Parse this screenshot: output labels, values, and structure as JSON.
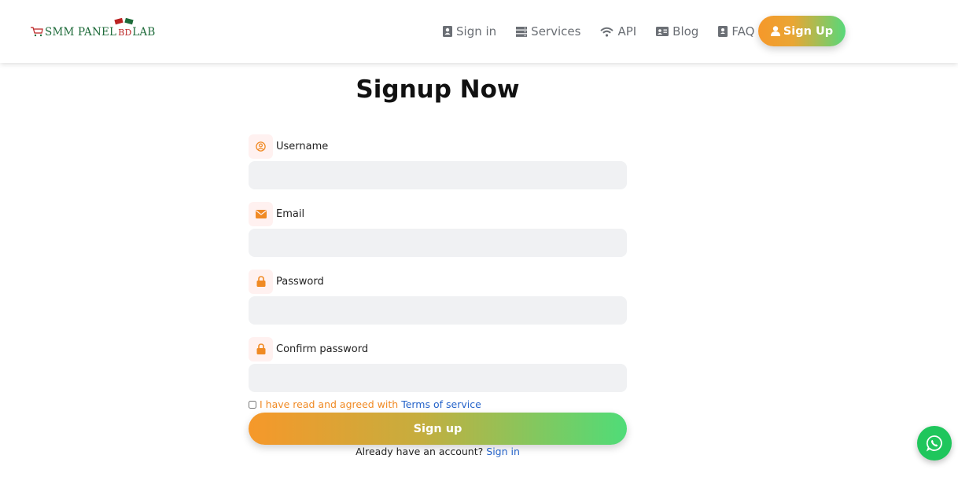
{
  "logo": {
    "text_left": "SMM PANEL",
    "text_mid": "BD",
    "text_right": "LAB"
  },
  "nav": {
    "items": [
      {
        "label": "Sign in",
        "icon": "user-card-icon"
      },
      {
        "label": "Services",
        "icon": "server-icon"
      },
      {
        "label": "API",
        "icon": "wifi-icon"
      },
      {
        "label": "Blog",
        "icon": "id-card-icon"
      },
      {
        "label": "FAQ",
        "icon": "book-icon"
      }
    ],
    "signup_label": "Sign Up"
  },
  "page": {
    "title": "Signup Now"
  },
  "form": {
    "username_label": "Username",
    "email_label": "Email",
    "password_label": "Password",
    "confirm_label": "Confirm password",
    "username_value": "",
    "email_value": "",
    "password_value": "",
    "confirm_value": "",
    "terms_text": "I have read and agreed with",
    "terms_link": "Terms of service",
    "submit_label": "Sign up",
    "already_text": "Already have an account?",
    "signin_link": "Sign in"
  },
  "colors": {
    "accent_orange": "#f6982a",
    "accent_green": "#4fdc78",
    "link_blue": "#2563c9",
    "whatsapp_green": "#1fc65c"
  }
}
